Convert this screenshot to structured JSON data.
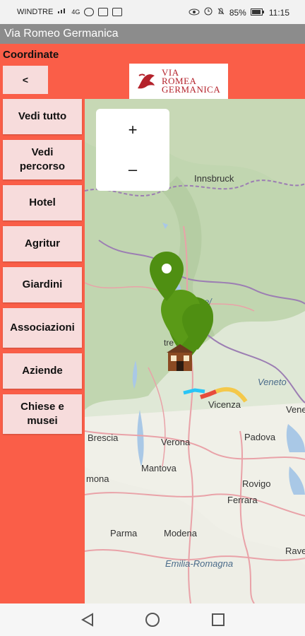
{
  "status_bar": {
    "carrier": "WINDTRE",
    "network": "4G",
    "battery": "85%",
    "time": "11:15"
  },
  "app": {
    "title": "Via Romeo Germanica"
  },
  "header": {
    "label": "Coordinate",
    "back_label": "<",
    "logo_lines": [
      "VIA",
      "ROMEA",
      "GERMANICA"
    ]
  },
  "menu": {
    "buttons": [
      {
        "label": "Vedi tutto"
      },
      {
        "label": "Vedi percorso"
      },
      {
        "label": "Hotel"
      },
      {
        "label": "Agritur"
      },
      {
        "label": "Giardini"
      },
      {
        "label": "Associazioni"
      },
      {
        "label": "Aziende"
      },
      {
        "label": "Chiese e musei"
      }
    ]
  },
  "map": {
    "zoom_in": "+",
    "zoom_out": "–",
    "places": [
      "Innsbruck",
      "Veneto",
      "Vicenza",
      "Vene",
      "Brescia",
      "Verona",
      "Padova",
      "Mantova",
      "Rovigo",
      "mona",
      "Ferrara",
      "Parma",
      "Modena",
      "Rave",
      "Emilia-Romagna",
      "ge/",
      "tre"
    ]
  }
}
